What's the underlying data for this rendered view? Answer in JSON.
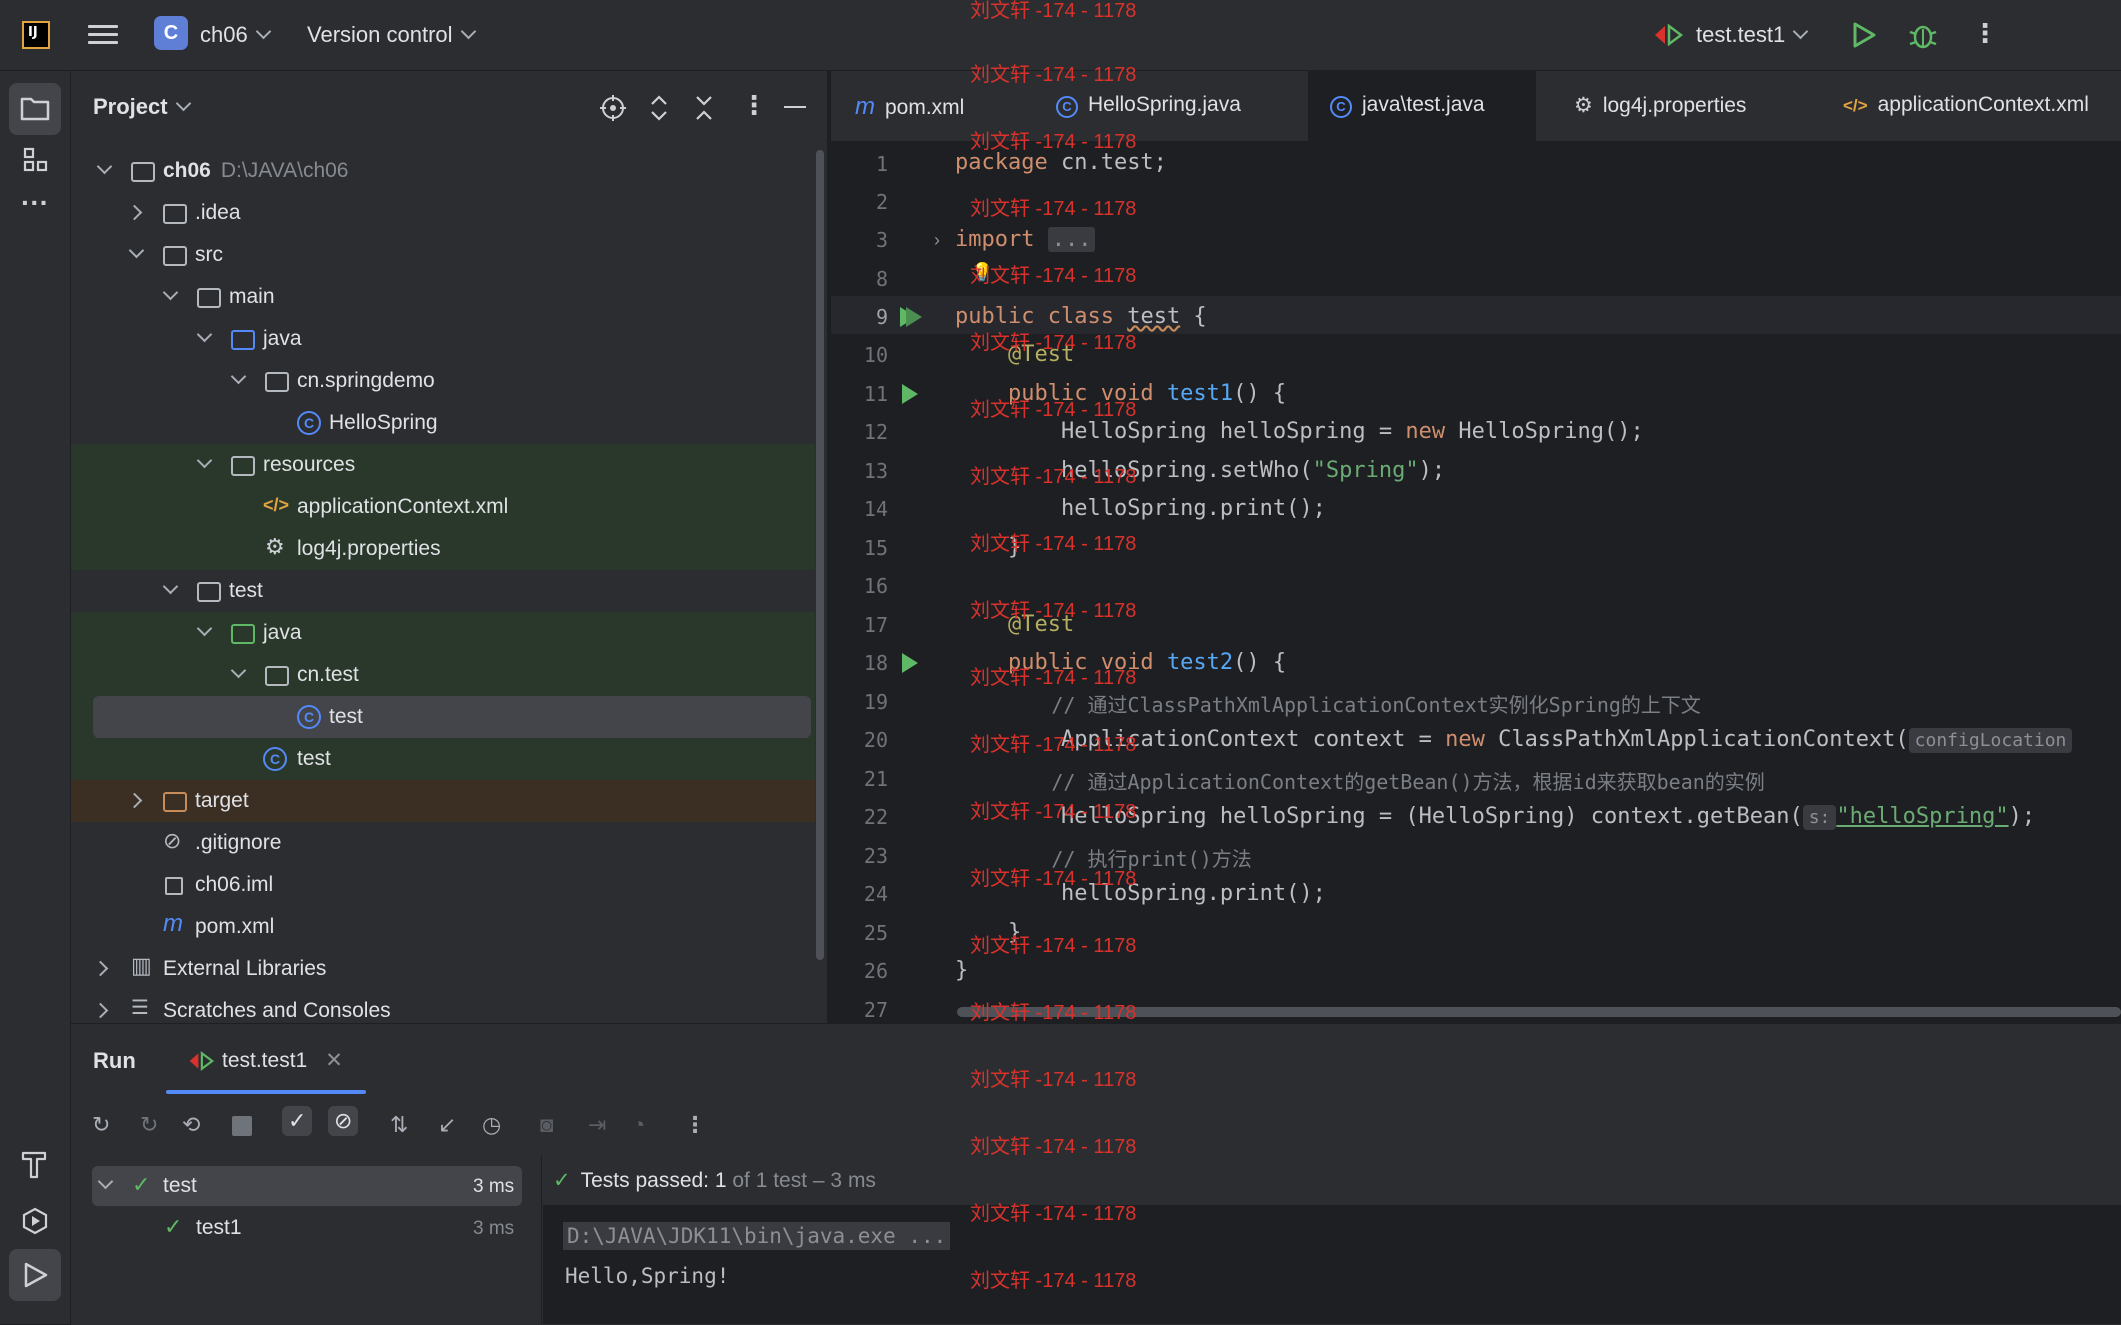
{
  "header": {
    "project_badge": "C",
    "project_name": "ch06",
    "version_control": "Version control",
    "run_config": "test.test1"
  },
  "project_panel": {
    "title": "Project",
    "tree": [
      {
        "label": "ch06",
        "extra": "D:\\JAVA\\ch06"
      },
      {
        "label": ".idea"
      },
      {
        "label": "src"
      },
      {
        "label": "main"
      },
      {
        "label": "java"
      },
      {
        "label": "cn.springdemo"
      },
      {
        "label": "HelloSpring"
      },
      {
        "label": "resources"
      },
      {
        "label": "applicationContext.xml"
      },
      {
        "label": "log4j.properties"
      },
      {
        "label": "test"
      },
      {
        "label": "java"
      },
      {
        "label": "cn.test"
      },
      {
        "label": "test"
      },
      {
        "label": "test"
      },
      {
        "label": "target"
      },
      {
        "label": ".gitignore"
      },
      {
        "label": "ch06.iml"
      },
      {
        "label": "pom.xml"
      },
      {
        "label": "External Libraries"
      },
      {
        "label": "Scratches and Consoles"
      }
    ]
  },
  "editor": {
    "tabs": [
      "pom.xml",
      "HelloSpring.java",
      "java\\test.java",
      "log4j.properties",
      "applicationContext.xml"
    ],
    "line_numbers": [
      "1",
      "2",
      "3",
      "8",
      "9",
      "10",
      "11",
      "12",
      "13",
      "14",
      "15",
      "16",
      "17",
      "18",
      "19",
      "20",
      "21",
      "22",
      "23",
      "24",
      "25",
      "26",
      "27"
    ],
    "code": {
      "l1_kw": "package",
      "l1_rest": " cn.test;",
      "l3_kw": "import",
      "l3_fold": "...",
      "l9_kw": "public class",
      "l9_name": "test",
      "l9_rest": " {",
      "l10": "@Test",
      "l11_kw": "public void",
      "l11_fn": "test1",
      "l11_rest": "() {",
      "l12_a": "HelloSpring helloSpring = ",
      "l12_kw": "new",
      "l12_b": " HelloSpring();",
      "l13_a": "helloSpring.setWho(",
      "l13_str": "\"Spring\"",
      "l13_b": ");",
      "l14": "helloSpring.print();",
      "l15": "}",
      "l17": "@Test",
      "l18_kw": "public void",
      "l18_fn": "test2",
      "l18_rest": "() {",
      "l19": "// 通过ClassPathXmlApplicationContext实例化Spring的上下文",
      "l20_a": "ApplicationContext context = ",
      "l20_kw": "new",
      "l20_b": " ClassPathXmlApplicationContext(",
      "l20_hint": "configLocation",
      "l21": "// 通过ApplicationContext的getBean()方法，根据id来获取bean的实例",
      "l22_a": "HelloSpring helloSpring = (HelloSpring) context.getBean(",
      "l22_hint": "s:",
      "l22_str": "\"helloSpring\"",
      "l22_b": ");",
      "l23": "// 执行print()方法",
      "l24": "helloSpring.print();",
      "l25": "}",
      "l26": "}"
    }
  },
  "run_panel": {
    "title": "Run",
    "tab": "test.test1",
    "tree": [
      {
        "label": "test",
        "time": "3 ms"
      },
      {
        "label": "test1",
        "time": "3 ms"
      }
    ],
    "status_bold": "Tests passed: 1",
    "status_rest": " of 1 test – 3 ms",
    "cmd": "D:\\JAVA\\JDK11\\bin\\java.exe ...",
    "output": "Hello,Spring!"
  },
  "watermark": "刘文轩 -174 - 1178",
  "colors": {
    "accent": "#548af7",
    "success": "#5fb865",
    "keyword": "#cf8e6d",
    "watermark": "#d9322c"
  }
}
